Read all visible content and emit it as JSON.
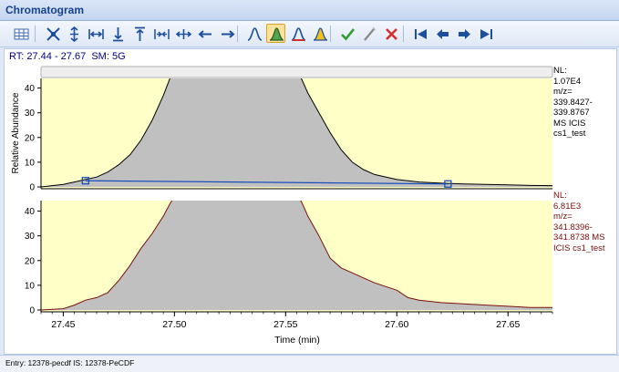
{
  "window": {
    "title": "Chromatogram"
  },
  "toolbar": {
    "buttons": [
      {
        "icon": "grid-table-icon"
      },
      {
        "icon": "zoom-fit-icon"
      },
      {
        "icon": "zoom-y-icon"
      },
      {
        "icon": "expand-x-icon"
      },
      {
        "icon": "scale-down-icon"
      },
      {
        "icon": "scale-up-icon"
      },
      {
        "icon": "zoom-x-in-icon"
      },
      {
        "icon": "zoom-x-out-icon"
      },
      {
        "icon": "arrow-left-icon"
      },
      {
        "icon": "arrow-right-icon"
      },
      {
        "icon": "peak-icon"
      },
      {
        "icon": "peak-selected-icon",
        "active": true
      },
      {
        "icon": "peak-red-icon"
      },
      {
        "icon": "peak-yellow-icon"
      },
      {
        "icon": "check-icon"
      },
      {
        "icon": "wand-icon"
      },
      {
        "icon": "delete-icon"
      },
      {
        "icon": "first-icon"
      },
      {
        "icon": "previous-icon"
      },
      {
        "icon": "next-icon"
      },
      {
        "icon": "last-icon"
      }
    ]
  },
  "header": {
    "rt_label": "RT:",
    "rt_value": "27.44 - 27.67",
    "sm_label": "SM:",
    "sm_value": "5G"
  },
  "traces": [
    {
      "lines": [
        "NL:",
        "1.07E4",
        "m/z=",
        "339.8427-",
        "339.8767",
        "MS  ICIS",
        "cs1_test"
      ],
      "color": "#000000"
    },
    {
      "lines": [
        "NL:",
        "6.81E3",
        "m/z=",
        "341.8396-",
        "341.8738 MS",
        " ICIS cs1_test"
      ],
      "color": "#7a0f0f"
    }
  ],
  "chart_data": {
    "type": "area",
    "xlabel": "Time (min)",
    "ylabel": "Relative Abundance",
    "xlim": [
      27.44,
      27.67
    ],
    "x_ticks": [
      "27.45",
      "27.50",
      "27.55",
      "27.60",
      "27.65"
    ],
    "y_ticks": [
      "0",
      "10",
      "20",
      "30",
      "40"
    ],
    "ylim": [
      0,
      45
    ],
    "background_color": "#ffffc8",
    "fill_color": "#c0c0c0",
    "panels": [
      {
        "x": [
          27.44,
          27.45,
          27.455,
          27.46,
          27.465,
          27.47,
          27.475,
          27.48,
          27.485,
          27.49,
          27.495,
          27.498,
          27.5,
          27.555,
          27.557,
          27.56,
          27.565,
          27.57,
          27.575,
          27.58,
          27.585,
          27.59,
          27.6,
          27.61,
          27.62,
          27.63,
          27.64,
          27.65,
          27.66,
          27.67
        ],
        "y": [
          0,
          1,
          2,
          3,
          4,
          6,
          9,
          13,
          19,
          27,
          37,
          44,
          46,
          46,
          44,
          38,
          30,
          22,
          15,
          10,
          7,
          5,
          3,
          2,
          1.5,
          1.2,
          1,
          0.8,
          0.6,
          0.5
        ],
        "line_color": "#000000",
        "baseline": {
          "x": [
            27.46,
            27.623
          ],
          "y": [
            2.5,
            1.2
          ]
        }
      },
      {
        "x": [
          27.44,
          27.45,
          27.455,
          27.46,
          27.465,
          27.47,
          27.475,
          27.48,
          27.485,
          27.49,
          27.495,
          27.498,
          27.5,
          27.555,
          27.557,
          27.56,
          27.565,
          27.57,
          27.575,
          27.58,
          27.585,
          27.59,
          27.6,
          27.605,
          27.61,
          27.62,
          27.63,
          27.64,
          27.65,
          27.66,
          27.67
        ],
        "y": [
          0,
          0.5,
          2,
          4,
          5,
          7,
          12,
          18,
          25,
          31,
          38,
          43,
          46,
          46,
          44,
          38,
          30,
          21,
          17,
          15,
          13,
          11,
          8,
          5,
          4,
          3,
          2.5,
          2,
          1.5,
          1,
          1
        ],
        "line_color": "#7a0f0f"
      }
    ]
  },
  "statusbar": {
    "text": "Entry: 12378-pecdf   IS: 12378-PeCDF"
  }
}
